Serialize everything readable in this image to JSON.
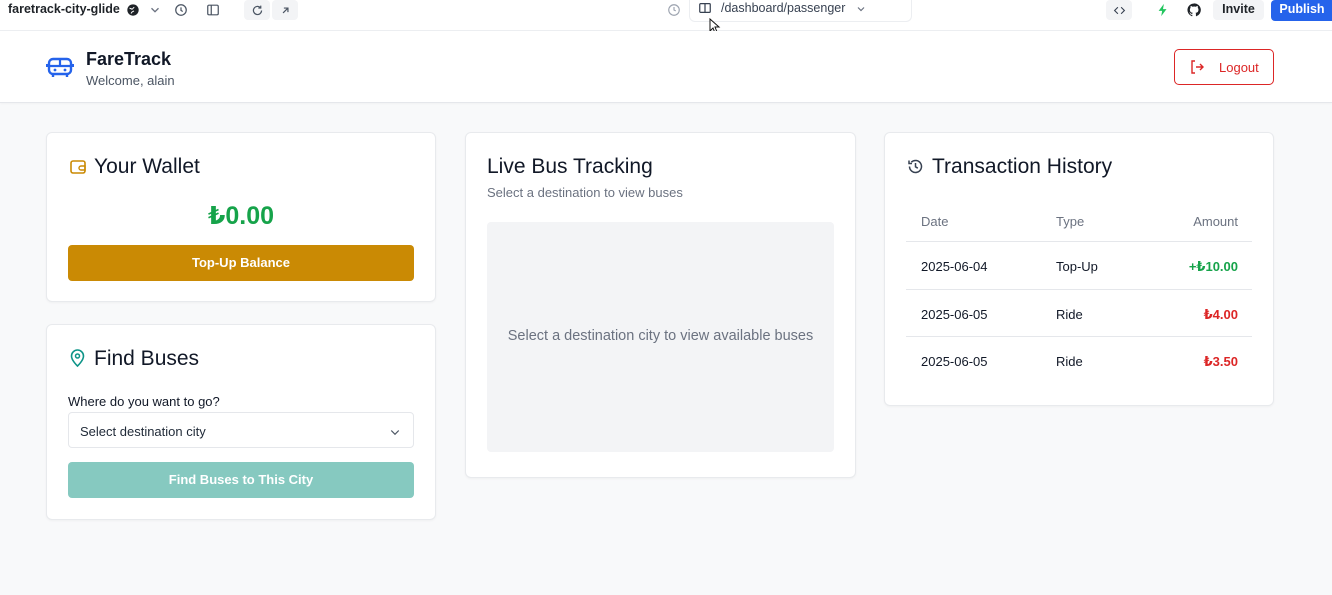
{
  "editor_toolbar": {
    "project_name": "faretrack-city-glide",
    "url_path": "/dashboard/passenger",
    "invite_label": "Invite",
    "publish_label": "Publish",
    "icons": [
      "globe-icon",
      "chevron-down-icon",
      "history-icon",
      "sidebar-toggle-icon",
      "refresh-icon",
      "external-link-icon",
      "compass-icon",
      "layout-icon",
      "code-icon",
      "bolt-icon",
      "github-icon"
    ]
  },
  "header": {
    "brand": "FareTrack",
    "welcome": "Welcome, alain",
    "logout_label": "Logout"
  },
  "wallet": {
    "title": "Your Wallet",
    "balance": "₺0.00",
    "topup_label": "Top-Up Balance"
  },
  "find_buses": {
    "title": "Find Buses",
    "label": "Where do you want to go?",
    "select_placeholder": "Select destination city",
    "button_label": "Find Buses to This City"
  },
  "live_tracking": {
    "title": "Live Bus Tracking",
    "subtitle": "Select a destination to view buses",
    "empty_message": "Select a destination city to view available buses"
  },
  "transactions": {
    "title": "Transaction History",
    "columns": [
      "Date",
      "Type",
      "Amount"
    ],
    "rows": [
      {
        "date": "2025-06-04",
        "type": "Top-Up",
        "amount": "+₺10.00"
      },
      {
        "date": "2025-06-05",
        "type": "Ride",
        "amount": "₺4.00"
      },
      {
        "date": "2025-06-05",
        "type": "Ride",
        "amount": "₺3.50"
      }
    ]
  },
  "colors": {
    "primary": "#2563eb",
    "wallet_accent": "#ca8a04",
    "positive": "#16a34a",
    "negative": "#dc2626",
    "teal": "#0d9488",
    "find_button_disabled": "#86c9c0"
  }
}
